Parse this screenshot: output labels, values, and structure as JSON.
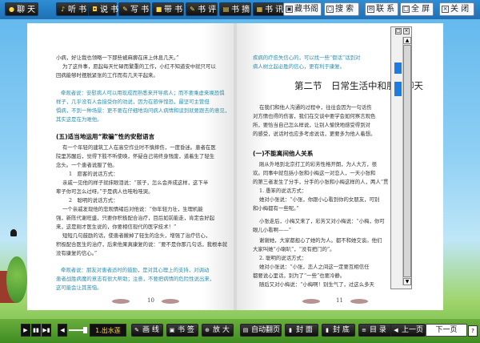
{
  "toolbar": {
    "items": [
      {
        "label": "聊 天",
        "icon": "chat-icon"
      },
      {
        "label": "听 书",
        "icon": "listen-icon"
      },
      {
        "label": "说 书",
        "icon": "speak-icon"
      },
      {
        "label": "写 书",
        "icon": "write-icon"
      },
      {
        "label": "带 书",
        "icon": "book-bag-icon"
      },
      {
        "label": "书 评",
        "icon": "review-icon"
      },
      {
        "label": "书 摘",
        "icon": "excerpt-icon"
      },
      {
        "label": "书 讯",
        "icon": "news-icon"
      },
      {
        "label": "书 友",
        "icon": "friends-icon"
      }
    ],
    "right": [
      {
        "label": "藏书阁",
        "icon": "library-icon"
      },
      {
        "label": "搜 索",
        "icon": "search-icon"
      },
      {
        "label": "联 系",
        "icon": "contact-icon"
      },
      {
        "label": "全 屏",
        "icon": "fullscreen-icon"
      },
      {
        "label": "关 闭",
        "icon": "close-icon"
      }
    ]
  },
  "left_page": {
    "lines": [
      "小病，好让我也领略一下那些被麻痹在床上休息几天。”",
      "为了这件事，愿起每天忙碌而繁重的工作，小红不知道安中就只可以",
      "回病能够时摆脱紧张的工作而有几天平起来。"
    ],
    "note1": [
      "牵观者说：安慰病人可以用现成而熟悉来开导病人；而不要乘虚来唤恐惧",
      "样子，几乎没有人会接受你的劝说，因为在旅伴惶恐，最坚可主管但",
      "惧病，不到一种场景：更不要在仔细地询问病人病情和谈到就要跟去的意见，",
      "其实这是在为难他。"
    ],
    "heading": "(五)适当地运用“欺骗”性的安慰语言",
    "body": [
      "有一个年轻的建筑工人在高空作业时不慎摔伤，一度昏迷。患者在医",
      "院里苏醒后，觉得下肢不听使唤，怀疑自己将终身残废，道着生了轻生",
      "念头。一个患者说服了他。",
      "1　愿客的说话方式：",
      "亲戚一见他的样子就抹眼泪说：“孩子，怎么会弄成这样，这下半",
      "辈子你可怎么过呀。”于是病人也哇啦哇哭。",
      "2　聪明的说话方式：",
      "一个亲戚发现他的悲观情绪后对他说：“你年轻力壮，生理机能",
      "强，新陈代谢旺盛，只要你积极配合治疗，目后如前能走，肯定会好起",
      "来，这是刚才医生说的，你要相信现代的医学技术！”",
      "短短几句鼓励的话，使患者撇掉了轻生的念头，增强了治疗信心，",
      "积极配合医生的治疗，后来他果真康复的说：“要不是你那几句话，我根本就",
      "没有康复的信心。”"
    ],
    "note2": [
      "牵观者说：朋友对患者适时的鼓励，是对其心理上的支持，对调动",
      "患者战胜病魔的意志有很大帮助；注意，不要把病情的危险性说出来，",
      "这可能会让其苦恼。"
    ],
    "page_number": "10"
  },
  "right_page": {
    "top_note": [
      "疾病的疗愈失信心的，可以找一些“假话”话到对",
      "病人树立起必胜的信心，更有利于康复。"
    ],
    "section_title": "第二节　日常生活中和朋友聊天",
    "intro": [
      "在我们和他人沟通的过程中，往往会因为一句话伤",
      "对方情也得的伤害，我们在交谈中要学会如何察言观色",
      "所，要恰当自己怎么样说，让别人愉快地感受得到对",
      "的感受，说话时也应多考虑说话，更要多为他人着想。"
    ],
    "heading": "(一)不能离间他人关系",
    "body": [
      "刚从外地到北京打工的彩芳性格开朗，为人大方，很",
      "欢。同事中就包括小张和小梅这一对恋人，一天小张和",
      "的第三者发生了分手，分手的小张和小梅这样的人，两人“贯",
      "1. 愚笨的说话方式：",
      "她对小张说：“小张，你跟小心看到你的女朋友，可别",
      "和小梅都有一些呢。”",
      "小张走后，小梅又来了，彩芳又对小梅说：“小梅，你可",
      "眼儿小看啊——”",
      "谢谢她，大家都担心了她的为人。都不和她交谈。他们",
      "大家叫她“小喇叭”，“没有把门的”。",
      "2. 聪明的说话方式：",
      "她对小张说：“小张，恋人之间这一定要互相信任",
      "都要说心里话，别为了“一些”也要冷静。"
    ],
    "tail": [
      "随后又对小梅说：“小梅啊！别生气了，过这么多天"
    ],
    "page_number": "11"
  },
  "popup": {
    "min_label": "□",
    "close_label": "×",
    "up_arrow": "▲",
    "down_arrow": "▼"
  },
  "bottom": {
    "audio_label": "1.出水莲",
    "items": [
      {
        "label": "画 线",
        "icon": "pen-icon"
      },
      {
        "label": "书 签",
        "icon": "bookmark-icon"
      },
      {
        "label": "放 大",
        "icon": "zoom-icon"
      },
      {
        "label": "自动翻页",
        "icon": "autoflip-icon"
      },
      {
        "label": "封 面",
        "icon": "cover-icon"
      },
      {
        "label": "封 底",
        "icon": "back-cover-icon"
      },
      {
        "label": "目 录",
        "icon": "contents-icon"
      },
      {
        "label": "上一页",
        "icon": "prev-icon"
      }
    ],
    "next_label": "下一页",
    "corner_icon": "?"
  },
  "colors": {
    "accent": "#2a8fb0",
    "toolbar": "#1f6fb3",
    "ground": "#3f8c22"
  }
}
